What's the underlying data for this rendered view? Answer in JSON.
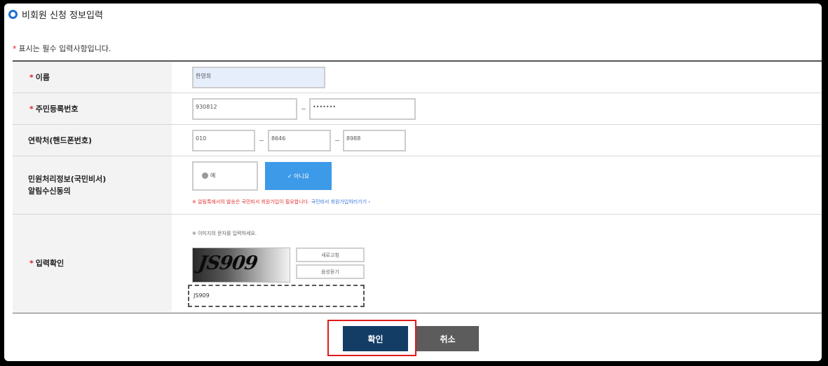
{
  "section": {
    "title": "비회원 신청 정보입력"
  },
  "required_note": "표시는 필수 입력사항입니다.",
  "required_mark": "*",
  "form": {
    "name": {
      "label": "이름",
      "value": "한영희"
    },
    "rrn": {
      "label": "주민등록번호",
      "part1": "930812",
      "part2": "•••••••"
    },
    "phone": {
      "label": "연락처(핸드폰번호)",
      "part1": "010",
      "part2": "8646",
      "part3": "8988"
    },
    "consent": {
      "label_line1": "민원처리정보(국민비서)",
      "label_line2": "알림수신동의",
      "option_label": "예",
      "button_label": "✓ 아니요",
      "notice_red": "※ 알림톡에서의 발송은 국민비서 회원가입이 필요합니다.",
      "notice_link": "국민비서 회원가입하러가기 ›"
    },
    "captcha": {
      "label": "입력확인",
      "hint": "※ 이미지의 문자를 입력하세요.",
      "image_text": "JS909",
      "refresh_label": "새로고침",
      "audio_label": "음성듣기",
      "input_value": "JS909"
    }
  },
  "actions": {
    "confirm": "확인",
    "cancel": "취소"
  },
  "colors": {
    "accent": "#143d66",
    "required": "#d81f26",
    "highlight": "#e01b1b"
  }
}
